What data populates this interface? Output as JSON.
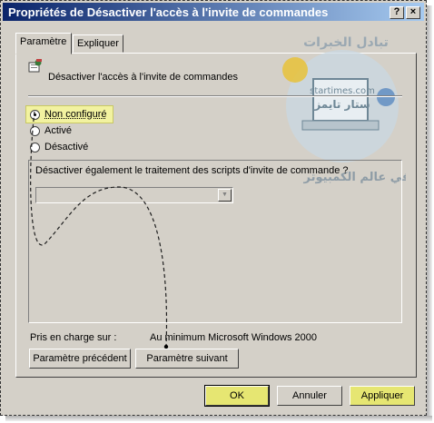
{
  "window": {
    "title": "Propriétés de Désactiver l'accès à l'invite de commandes",
    "help_button": "?",
    "close_button": "×"
  },
  "tabs": [
    {
      "label": "Paramètre",
      "active": true
    },
    {
      "label": "Expliquer",
      "active": false
    }
  ],
  "setting": {
    "name": "Désactiver l'accès à l'invite de commandes",
    "icon": "policy-icon"
  },
  "options": [
    {
      "label": "Non configuré",
      "selected": true
    },
    {
      "label": "Activé",
      "selected": false
    },
    {
      "label": "Désactivé",
      "selected": false
    }
  ],
  "group": {
    "question": "Désactiver également le traitement des scripts d'invite de commande ?",
    "combo_value": ""
  },
  "support": {
    "label": "Pris en charge sur :",
    "value": "Au minimum Microsoft Windows 2000"
  },
  "nav": {
    "prev": "Paramètre précédent",
    "next": "Paramètre suivant"
  },
  "footer": {
    "ok": "OK",
    "cancel": "Annuler",
    "apply": "Appliquer"
  },
  "watermark": {
    "line1": "تبادل الخبرات",
    "line2": "startimes.com",
    "line3": "ستار تايمز",
    "line4": "في عالم الكمبيوتر"
  },
  "colors": {
    "title_gradient_start": "#0a246a",
    "title_gradient_end": "#a6caf0",
    "highlight": "#e6e672",
    "dialog_bg": "#d4d0c8"
  }
}
